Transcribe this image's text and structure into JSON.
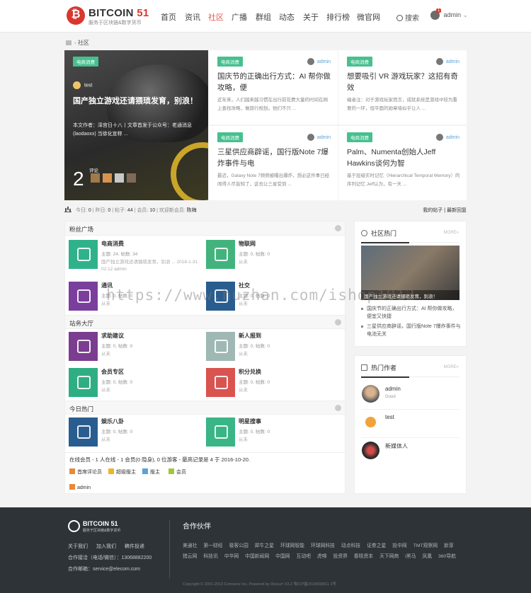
{
  "header": {
    "logo_text": "BITCOIN",
    "logo_num": "51",
    "logo_sub": "服务于区块链&数字货币",
    "nav": [
      "首页",
      "资讯",
      "社区",
      "广播",
      "群组",
      "动态",
      "关于",
      "排行榜",
      "微官网"
    ],
    "active_nav": "社区",
    "search_label": "搜索",
    "user_name": "admin",
    "user_badge": "1"
  },
  "breadcrumb": {
    "current": "社区"
  },
  "hero": {
    "big": {
      "tag": "电商消费",
      "author": "test",
      "title": "国产独立游戏还请猥琐发育，别浪！",
      "excerpt": "本文作者：泽宫日十八丨文章首发于公众号：老通消息(laodaoxx) 当徐化宣称 ...",
      "comments": "2",
      "comments_label": "评论"
    },
    "cards": [
      {
        "tag": "电商消费",
        "author": "admin",
        "title": "国庆节的正确出行方式：AI 帮你做攻略，便",
        "excerpt": "近年来，人们越来越习惯在出行前花费大量的时间在网上查找攻略，做旅行规划。他们不只 ..."
      },
      {
        "tag": "电商消费",
        "author": "admin",
        "title": "想要吸引 VR 游戏玩家？这招有奇效",
        "excerpt": "编者注：对于游戏玩家而言，成就系统是游戏中较为重要的一环，但平面的勋章墙似乎让人 ..."
      },
      {
        "tag": "电商消费",
        "author": "admin",
        "title": "三星供应商辟谣，国行版Note 7爆炸事件与电",
        "excerpt": "最近，Galaxy Note 7频频被曝出爆炸，想必这件事已经闹得人尽皆知了，这也让三星受到 ..."
      },
      {
        "tag": "电商消费",
        "author": "admin",
        "title": "Palm、Numenta创始人Jeff Hawkins谈何为智",
        "excerpt": "基于层级实时记忆（Hierarchical Temporal Memory）的序列记忆 Jeff认为，有一天 ..."
      }
    ]
  },
  "stats": {
    "today_label": "今日:",
    "today": "0",
    "yesterday_label": "昨日:",
    "yesterday": "0",
    "posts_label": "帖子:",
    "posts": "44",
    "members_label": "会员:",
    "members": "10",
    "welcome_label": "欢迎新会员:",
    "new_member": "陈梅",
    "my_posts": "我的帖子",
    "latest_reply": "最新回复"
  },
  "forum": {
    "sections": [
      "粉丝广场",
      "站务大厅",
      "今日热门"
    ],
    "boards": [
      {
        "name": "电商消费",
        "meta": "主题: 24, 帖数: 34",
        "last": "国产独立游戏还请猥琐发育，别浪 ... 2018-1-31 02:12 admin",
        "color": "#2fb28a"
      },
      {
        "name": "物联网",
        "meta": "主题: 0, 帖数: 0",
        "last": "从未",
        "color": "#43b37d"
      },
      {
        "name": "通讯",
        "meta": "主题: 0, 帖数: 0",
        "last": "从未",
        "color": "#7a3e9d"
      },
      {
        "name": "社交",
        "meta": "主题: 0, 帖数: 0",
        "last": "从未",
        "color": "#2a5d8f"
      },
      {
        "name": "求助建议",
        "meta": "主题: 0, 帖数: 0",
        "last": "从未",
        "color": "#7b3d8f"
      },
      {
        "name": "新人报到",
        "meta": "主题: 0, 帖数: 0",
        "last": "从未",
        "color": "#9fb8b3"
      },
      {
        "name": "会员专区",
        "meta": "主题: 0, 帖数: 0",
        "last": "从未",
        "color": "#2fae84"
      },
      {
        "name": "积分兑换",
        "meta": "主题: 0, 帖数: 0",
        "last": "从未",
        "color": "#d9534f"
      },
      {
        "name": "娱乐八卦",
        "meta": "主题: 0, 帖数: 0",
        "last": "从未",
        "color": "#2a5d8f"
      },
      {
        "name": "明星搜事",
        "meta": "主题: 0, 帖数: 0",
        "last": "从未",
        "color": "#3ab586"
      }
    ],
    "online_line": "在线会员 - 1 人在线 - 1 会员(0 隐身), 0 位游客 - 最高记录是 4 于 2016-10-20.",
    "legend": [
      "首席评论员",
      "超级版主",
      "版主",
      "会员"
    ],
    "legend_colors": [
      "#e8893a",
      "#f0b429",
      "#5aa2d8",
      "#a4c639"
    ],
    "online_user": "admin"
  },
  "sidebar": {
    "hot_title": "社区热门",
    "more": "MORE»",
    "hot_caption": "国产独立游戏还请猥琐发育，别浪！",
    "hot_items": [
      "国庆节的正确出行方式：AI 帮你做攻略，便宜又快捷",
      "三星供应商辟谣，国行版Note 7爆炸事件与电池无关"
    ],
    "authors_title": "热门作者",
    "authors": [
      {
        "name": "admin",
        "sub": "Good"
      },
      {
        "name": "test",
        "sub": ""
      },
      {
        "name": "新媒体人",
        "sub": ""
      }
    ]
  },
  "footer": {
    "logo_text": "BITCOIN",
    "logo_num": "51",
    "logo_sub": "服务于区块链&数字货币",
    "links": [
      "关于我们",
      "加入我们",
      "稿件投递"
    ],
    "contact_phone": "合作接洽（电话/微信）：13068882200",
    "contact_email": "合作邮箱：service@elecom.com",
    "partners_title": "合作伙伴",
    "partners": [
      "美通社",
      "第一财经",
      "极客公园",
      "犀牛之星",
      "环球网智能",
      "环球网科技",
      "动点科技",
      "证券之星",
      "投中网",
      "TMT观察网",
      "新芽",
      "猎云网",
      "科技讯",
      "中华网",
      "中国新闻网",
      "中国网",
      "互动吧",
      "虎嗅",
      "投资界",
      "春晓资本",
      "天下网商",
      "i黑马",
      "凤凰",
      "360导航"
    ],
    "copyright": "Copyright © 2001-2013 Comsenz Inc. Powered by Discuz! X3.2 粤ICP备2018009811 3号"
  },
  "watermark": "https://www.huzhan.com/ishop1012"
}
